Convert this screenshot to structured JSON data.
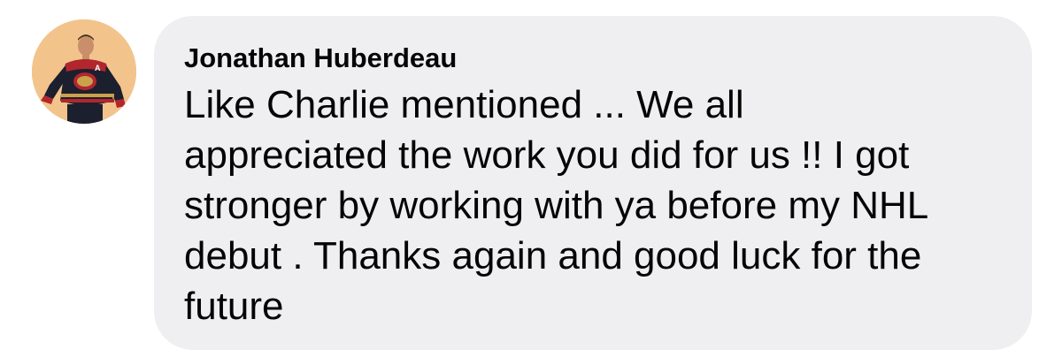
{
  "comment": {
    "author": "Jonathan Huberdeau",
    "avatar_icon": "profile-photo-hockey-player",
    "text_lines": [
      "Like Charlie mentioned ... We all",
      "appreciated the work you did for us !! I got",
      "stronger by working with ya before my NHL",
      "debut . Thanks again and good luck for the",
      "future"
    ]
  },
  "colors": {
    "bubble_background": "#efeff1",
    "text": "#050505",
    "page_background": "#ffffff"
  }
}
